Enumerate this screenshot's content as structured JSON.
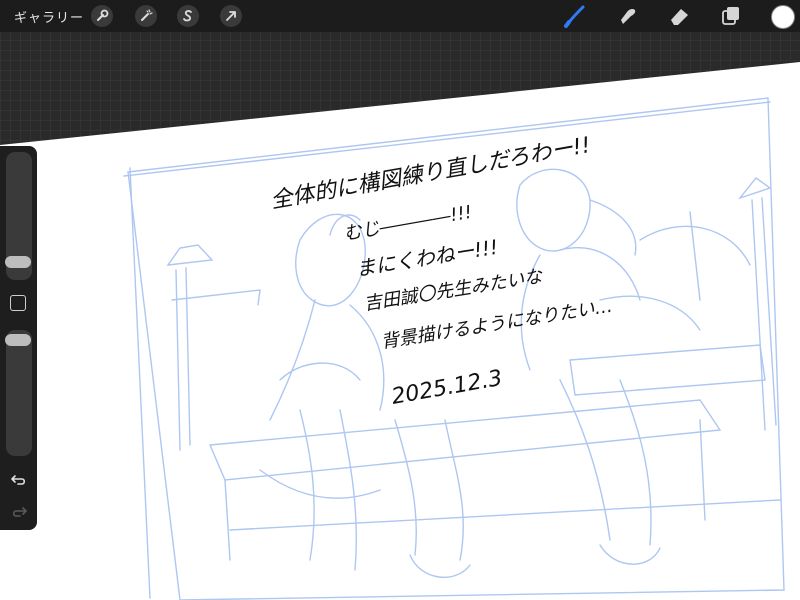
{
  "toolbar": {
    "gallery_label": "ギャラリー",
    "left_tools": [
      {
        "name": "actions",
        "icon": "wrench-icon"
      },
      {
        "name": "adjustments",
        "icon": "magic-wand-icon"
      },
      {
        "name": "selection",
        "icon": "selection-s-icon"
      },
      {
        "name": "transform",
        "icon": "arrow-cursor-icon"
      }
    ],
    "right_tools": [
      {
        "name": "brush",
        "icon": "brush-icon",
        "active": true
      },
      {
        "name": "smudge",
        "icon": "smudge-icon"
      },
      {
        "name": "eraser",
        "icon": "eraser-icon"
      },
      {
        "name": "layers",
        "icon": "layers-icon"
      }
    ],
    "current_color": "#ffffff",
    "active_tool_color": "#2f7bf5"
  },
  "sidebar": {
    "brush_size_level": 0.9,
    "opacity_level": 0.97,
    "icons": [
      "modify-square-icon",
      "undo-icon",
      "redo-icon"
    ]
  },
  "canvas": {
    "sketch_line_color": "#a9c4f2",
    "note_lines": [
      "全体的に構図練り直しだろわー!!",
      "むじ――――!!!",
      "まにくわねー!!!",
      "吉田誠〇先生みたいな",
      "背景描けるようになりたい…",
      "2025.12.3"
    ]
  }
}
